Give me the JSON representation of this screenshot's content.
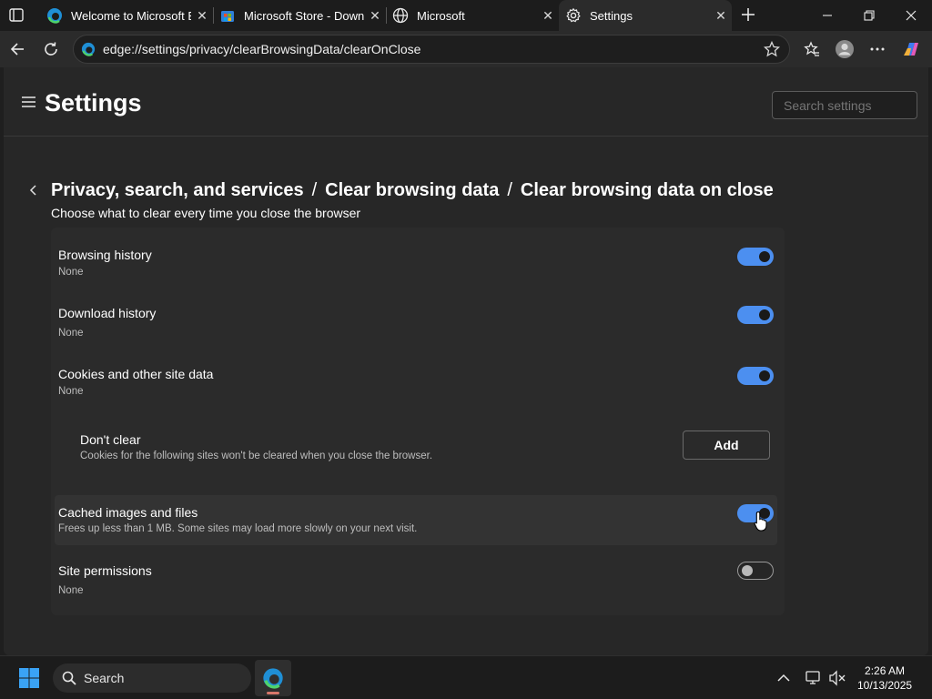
{
  "tabs": [
    {
      "label": "Welcome to Microsoft E",
      "icon": "edge-icon"
    },
    {
      "label": "Microsoft Store - Downl",
      "icon": "store-icon"
    },
    {
      "label": "Microsoft",
      "icon": "globe-icon"
    },
    {
      "label": "Settings",
      "icon": "gear-icon",
      "active": true
    }
  ],
  "address_bar": {
    "url": "edge://settings/privacy/clearBrowsingData/clearOnClose"
  },
  "settings": {
    "title": "Settings",
    "search_placeholder": "Search settings"
  },
  "breadcrumb": {
    "part1": "Privacy, search, and services",
    "part2": "Clear browsing data",
    "part3": "Clear browsing data on close",
    "separator": "/"
  },
  "page_subtitle": "Choose what to clear every time you close the browser",
  "items": [
    {
      "title": "Browsing history",
      "desc": "None",
      "enabled": true
    },
    {
      "title": "Download history",
      "desc": "None",
      "enabled": true
    },
    {
      "title": "Cookies and other site data",
      "desc": "None",
      "enabled": true
    },
    {
      "title": "Cached images and files",
      "desc": "Frees up less than 1 MB. Some sites may load more slowly on your next visit.",
      "enabled": true
    },
    {
      "title": "Site permissions",
      "desc": "None",
      "enabled": false
    }
  ],
  "dont_clear": {
    "title": "Don't clear",
    "desc": "Cookies for the following sites won't be cleared when you close the browser.",
    "button": "Add"
  },
  "taskbar": {
    "search_label": "Search",
    "time": "2:26 AM",
    "date": "10/13/2025"
  },
  "colors": {
    "accent": "#4c8ff0",
    "background": "#272727",
    "card": "#2b2b2b"
  }
}
